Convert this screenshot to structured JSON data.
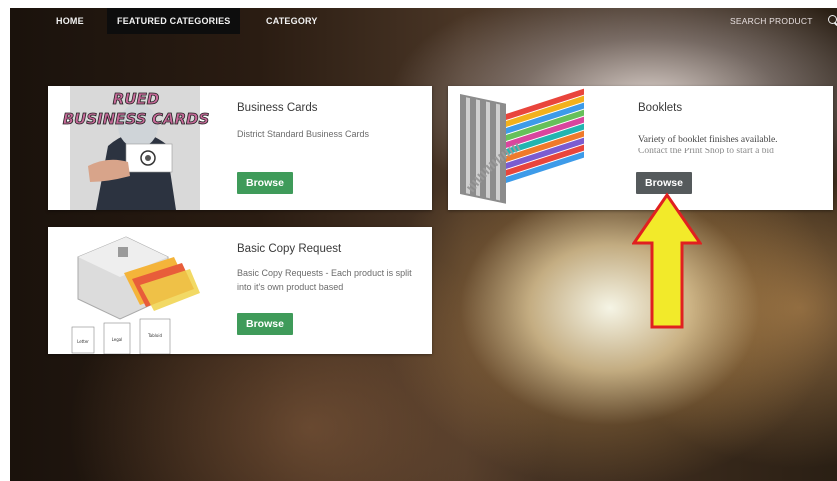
{
  "nav": {
    "home": "HOME",
    "featured": "FEATURED CATEGORIES",
    "category": "CATEGORY",
    "search": "SEARCH PRODUCT"
  },
  "cards": [
    {
      "title": "Business Cards",
      "desc": "District Standard Business Cards",
      "button": "Browse",
      "thumb_text": "RUED BUSINESS CARDS"
    },
    {
      "title": "Booklets",
      "desc": "Variety of booklet finishes available.",
      "desc_more": "Contact the Print Shop to start a bid",
      "button": "Browse"
    },
    {
      "title": "Basic Copy Request",
      "desc": "Basic Copy Requests - Each product is split into it's own product based",
      "button": "Browse",
      "thumb_labels": [
        "Letter",
        "Legal",
        "Tabloid"
      ]
    }
  ],
  "colors": {
    "accent": "#3f9b5a",
    "button_active": "#555a5c",
    "arrow_fill": "#f2ea2a",
    "arrow_stroke": "#e02020"
  }
}
